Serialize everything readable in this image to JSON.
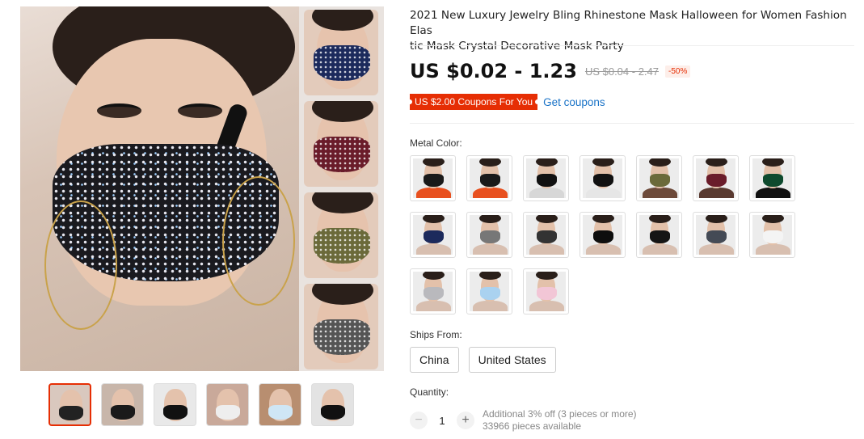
{
  "product": {
    "title": "2021 New Luxury Jewelry Bling Rhinestone Mask Halloween for Women Fashion Elastic Mask Crystal Decorative Mask Party",
    "title_line1": "2021 New Luxury Jewelry Bling Rhinestone Mask Halloween for Women Fashion Elas",
    "title_line2": "tic Mask Crystal Decorative Mask Party"
  },
  "pricing": {
    "price": "US $0.02 - 1.23",
    "original_price": "US $0.04 - 2.47",
    "discount": "-50%"
  },
  "coupon": {
    "label": "US $2.00 Coupons For You",
    "link": "Get coupons"
  },
  "variants": {
    "label": "Metal Color:",
    "swatches": [
      {
        "mask": "#1a1a1a",
        "body": "#e8501f"
      },
      {
        "mask": "#1a1a1a",
        "body": "#e8501f"
      },
      {
        "mask": "#111111",
        "body": "#d7d7d7"
      },
      {
        "mask": "#111111",
        "body": "#e6e6e6"
      },
      {
        "mask": "#6b6a3a",
        "body": "#6d4a3a"
      },
      {
        "mask": "#6a1c2a",
        "body": "#5a3a30"
      },
      {
        "mask": "#0e4a2e",
        "body": "#111111"
      },
      {
        "mask": "#1c2a5c",
        "body": "#d8bfb0"
      },
      {
        "mask": "#777777",
        "body": "#d8bfb0"
      },
      {
        "mask": "#333333",
        "body": "#d8bfb0"
      },
      {
        "mask": "#0e0e0e",
        "body": "#d8bfb0"
      },
      {
        "mask": "#151515",
        "body": "#d8bfb0"
      },
      {
        "mask": "#444a55",
        "body": "#d8bfb0"
      },
      {
        "mask": "#f4f4f4",
        "body": "#d8bfb0"
      },
      {
        "mask": "#b9b9bd",
        "body": "#d8bfb0"
      },
      {
        "mask": "#aad2f0",
        "body": "#d8bfb0"
      },
      {
        "mask": "#f2c6d6",
        "body": "#d8bfb0"
      }
    ]
  },
  "shipping": {
    "label": "Ships From:",
    "options": [
      "China",
      "United States"
    ]
  },
  "quantity": {
    "label": "Quantity:",
    "value": "1",
    "minus": "−",
    "plus": "+",
    "promo": "Additional 3% off (3 pieces or more)",
    "available": "33966 pieces available"
  },
  "gallery": {
    "thumbnails": [
      {
        "mask": "#222222",
        "bg": "#d9c8be"
      },
      {
        "mask": "#1a1a1a",
        "bg": "#c8b6aa"
      },
      {
        "mask": "#111111",
        "bg": "#e9e9e9"
      },
      {
        "mask": "#eeeeee",
        "bg": "#c9a99a"
      },
      {
        "mask": "#cfe6f5",
        "bg": "#b88e70"
      },
      {
        "mask": "#111111",
        "bg": "#e3e3e3"
      }
    ],
    "side_masks": [
      "#1c2a5c",
      "#6a1c2a",
      "#6b6a3a",
      "#555555"
    ]
  },
  "colors": {
    "accent": "#e62e04",
    "link": "#1a73c7"
  }
}
